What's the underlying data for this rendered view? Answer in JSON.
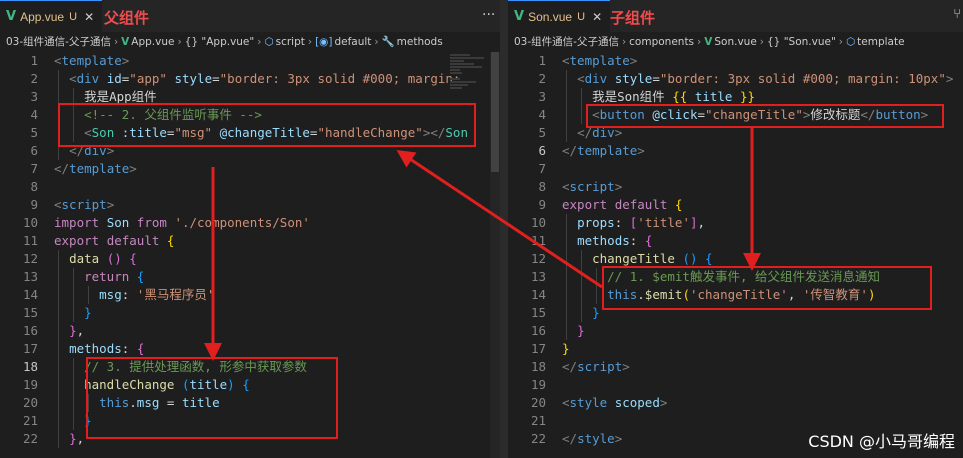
{
  "left": {
    "tab": {
      "name": "App.vue",
      "status": "U",
      "annotation": "父组件"
    },
    "more_label": "···",
    "breadcrumb": {
      "folder": "03-组件通信-父子通信",
      "file": "App.vue",
      "obj": "{} \"App.vue\"",
      "script": "script",
      "default": "default",
      "methods": "methods"
    }
  },
  "right": {
    "tab": {
      "name": "Son.vue",
      "status": "U",
      "annotation": "子组件"
    },
    "breadcrumb": {
      "folder": "03-组件通信-父子通信",
      "components": "components",
      "file": "Son.vue",
      "obj": "{} \"Son.vue\"",
      "template": "template"
    }
  },
  "colors": {
    "annotation": "#e21f1f",
    "vue_icon": "#41b883",
    "background": "#1e1e1e"
  },
  "watermark": "CSDN @小马哥编程"
}
